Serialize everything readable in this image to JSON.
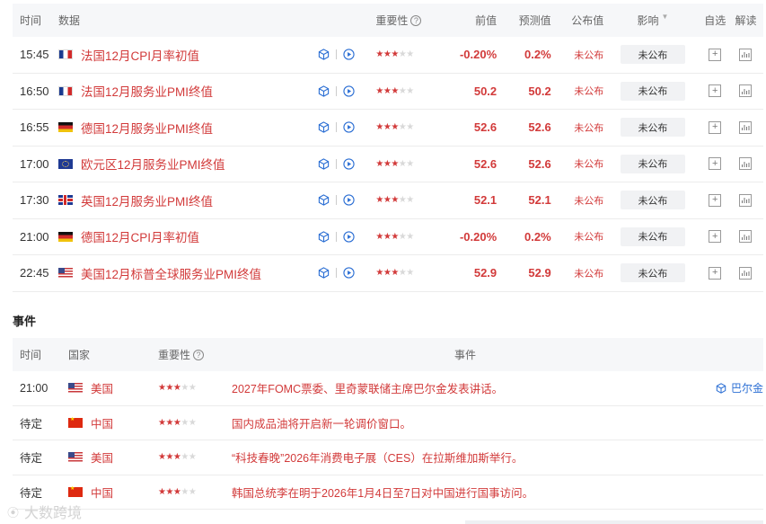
{
  "calendar": {
    "headers": {
      "time": "时间",
      "data": "数据",
      "importance": "重要性",
      "previous": "前值",
      "forecast": "预测值",
      "published": "公布值",
      "impact": "影响",
      "favorite": "自选",
      "interpret": "解读"
    },
    "rows": [
      {
        "time": "15:45",
        "flag": "fr",
        "name": "法国12月CPI月率初值",
        "stars": 3,
        "previous": "-0.20%",
        "forecast": "0.2%",
        "published": "未公布",
        "impact": "未公布"
      },
      {
        "time": "16:50",
        "flag": "fr",
        "name": "法国12月服务业PMI终值",
        "stars": 3,
        "previous": "50.2",
        "forecast": "50.2",
        "published": "未公布",
        "impact": "未公布"
      },
      {
        "time": "16:55",
        "flag": "de",
        "name": "德国12月服务业PMI终值",
        "stars": 3,
        "previous": "52.6",
        "forecast": "52.6",
        "published": "未公布",
        "impact": "未公布"
      },
      {
        "time": "17:00",
        "flag": "eu",
        "name": "欧元区12月服务业PMI终值",
        "stars": 3,
        "previous": "52.6",
        "forecast": "52.6",
        "published": "未公布",
        "impact": "未公布"
      },
      {
        "time": "17:30",
        "flag": "uk",
        "name": "英国12月服务业PMI终值",
        "stars": 3,
        "previous": "52.1",
        "forecast": "52.1",
        "published": "未公布",
        "impact": "未公布"
      },
      {
        "time": "21:00",
        "flag": "de",
        "name": "德国12月CPI月率初值",
        "stars": 3,
        "previous": "-0.20%",
        "forecast": "0.2%",
        "published": "未公布",
        "impact": "未公布"
      },
      {
        "time": "22:45",
        "flag": "us",
        "name": "美国12月标普全球服务业PMI终值",
        "stars": 3,
        "previous": "52.9",
        "forecast": "52.9",
        "published": "未公布",
        "impact": "未公布"
      }
    ]
  },
  "events": {
    "title": "事件",
    "headers": {
      "time": "时间",
      "country": "国家",
      "importance": "重要性",
      "event": "事件"
    },
    "rows": [
      {
        "time": "21:00",
        "flag": "us",
        "country": "美国",
        "stars": 3,
        "text": "2027年FOMC票委、里奇蒙联储主席巴尔金发表讲话。",
        "link": "巴尔金"
      },
      {
        "time": "待定",
        "flag": "cn",
        "country": "中国",
        "stars": 3,
        "text": "国内成品油将开启新一轮调价窗口。",
        "link": ""
      },
      {
        "time": "待定",
        "flag": "us",
        "country": "美国",
        "stars": 3,
        "text": "“科技春晚”2026年消费电子展（CES）在拉斯维加斯举行。",
        "link": ""
      },
      {
        "time": "待定",
        "flag": "cn",
        "country": "中国",
        "stars": 3,
        "text": "韩国总统李在明于2026年1月4日至7日对中国进行国事访问。",
        "link": ""
      }
    ]
  },
  "watermark": {
    "text": "大数跨境"
  },
  "colors": {
    "accent_red": "#d23a3a",
    "link_blue": "#2c6fd4",
    "header_bg": "#f6f7f9"
  }
}
